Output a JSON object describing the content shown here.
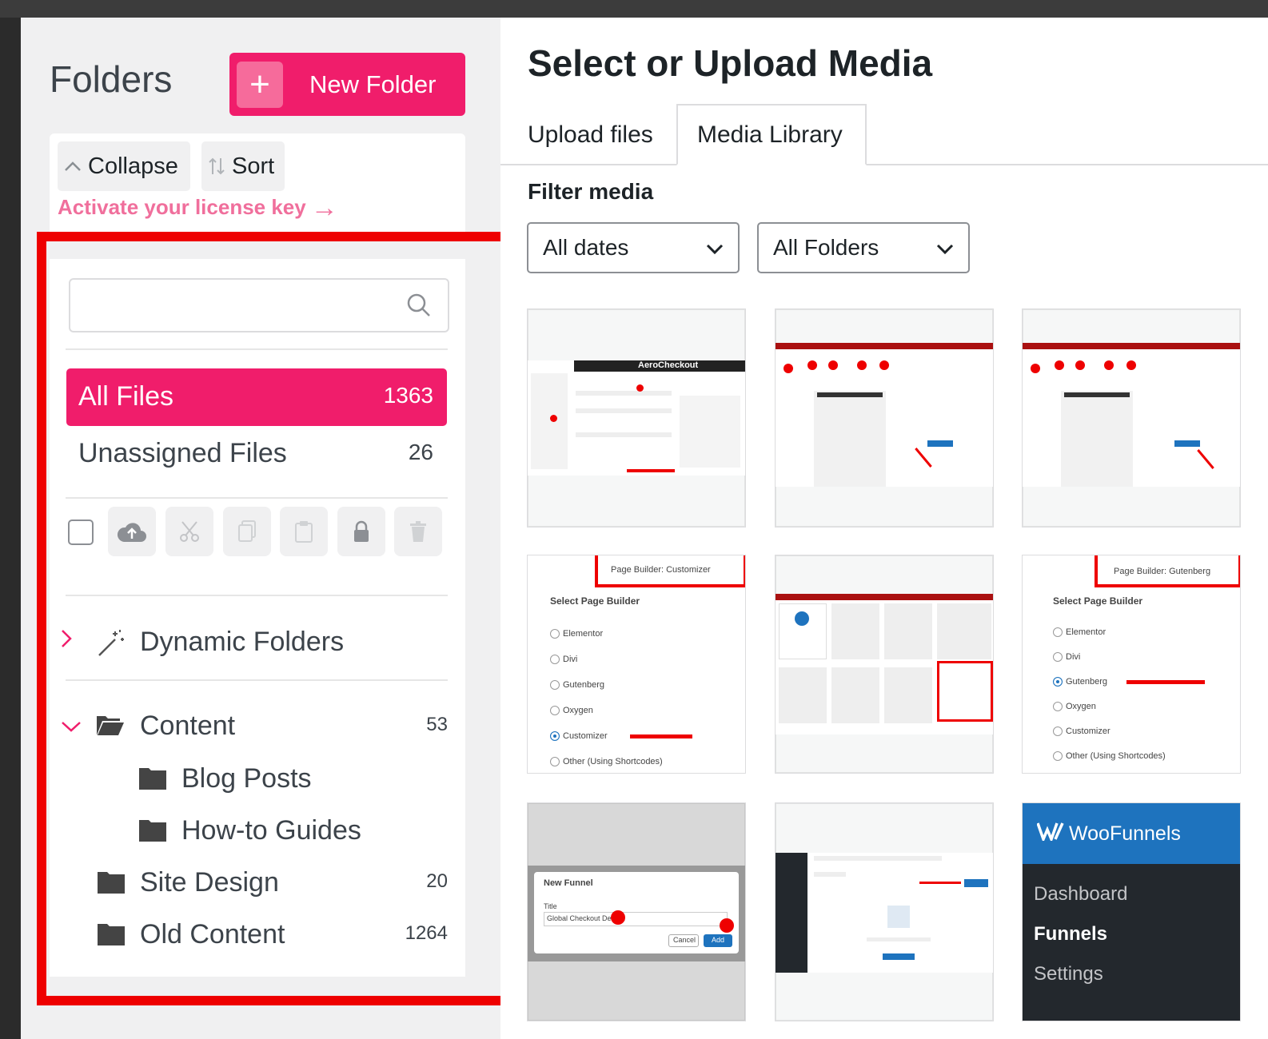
{
  "sidebar": {
    "title": "Folders",
    "new_folder_label": "New Folder",
    "collapse_label": "Collapse",
    "sort_label": "Sort",
    "license_text": "Activate your license key",
    "search_placeholder": "",
    "all_files": {
      "label": "All Files",
      "count": "1363"
    },
    "unassigned": {
      "label": "Unassigned Files",
      "count": "26"
    },
    "dynamic_folders_label": "Dynamic Folders",
    "folders": [
      {
        "label": "Content",
        "count": "53"
      },
      {
        "label": "Blog Posts",
        "count": ""
      },
      {
        "label": "How-to Guides",
        "count": ""
      },
      {
        "label": "Site Design",
        "count": "20"
      },
      {
        "label": "Old Content",
        "count": "1264"
      }
    ]
  },
  "media": {
    "title": "Select or Upload Media",
    "tabs": [
      {
        "label": "Upload files"
      },
      {
        "label": "Media Library"
      }
    ],
    "filter_label": "Filter media",
    "date_filter": "All dates",
    "folder_filter": "All Folders"
  },
  "thumbs": {
    "aero": "AeroCheckout",
    "customizer": {
      "page_builder": "Page Builder:  Customizer",
      "heading": "Select Page Builder",
      "options": [
        "Elementor",
        "Divi",
        "Gutenberg",
        "Oxygen",
        "Customizer",
        "Other (Using Shortcodes)"
      ]
    },
    "gutenberg": {
      "page_builder": "Page Builder:  Gutenberg",
      "heading": "Select Page Builder",
      "options": [
        "Elementor",
        "Divi",
        "Gutenberg",
        "Oxygen",
        "Customizer",
        "Other (Using Shortcodes)"
      ]
    },
    "new_funnel": {
      "title": "New Funnel",
      "field_label": "Title",
      "field_value": "Global Checkout Default",
      "cancel": "Cancel",
      "add": "Add"
    },
    "woofunnels": {
      "brand": "WooFunnels",
      "menu": [
        "Dashboard",
        "Funnels",
        "Settings"
      ]
    }
  },
  "colors": {
    "accent": "#f01d6b",
    "highlight": "#ee0000",
    "wp_blue": "#1e73be"
  }
}
